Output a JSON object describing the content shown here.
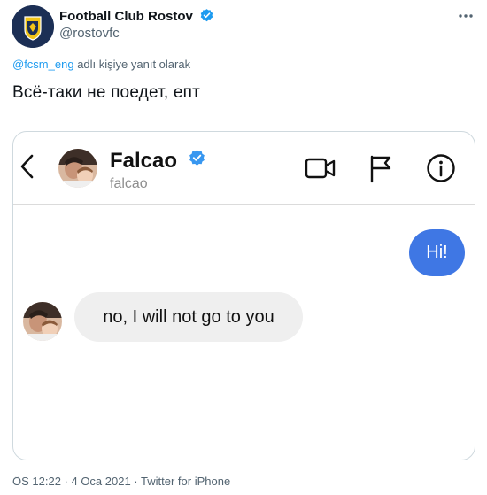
{
  "tweet": {
    "author_name": "Football Club Rostov",
    "author_handle": "@rostovfc",
    "reply_mention": "@fcsm_eng",
    "reply_suffix": "adlı kişiye yanıt olarak",
    "text": "Всё-таки не поедет, епт",
    "meta": "ÖS 12:22 · 4 Oca 2021 · Twitter for iPhone"
  },
  "dm": {
    "name": "Falcao",
    "username": "falcao",
    "outgoing_message": "Hi!",
    "incoming_message": "no, I will not go to you"
  },
  "colors": {
    "twitter_blue": "#1d9bf0",
    "outgoing_bubble": "#3f77e4",
    "incoming_bubble": "#efefef",
    "club_navy": "#1c2f55",
    "club_gold": "#f2c518"
  },
  "icons": {
    "verified": "verified-icon",
    "more": "more-icon",
    "back": "back-icon",
    "video": "video-call-icon",
    "flag": "flag-icon",
    "info": "info-icon"
  }
}
